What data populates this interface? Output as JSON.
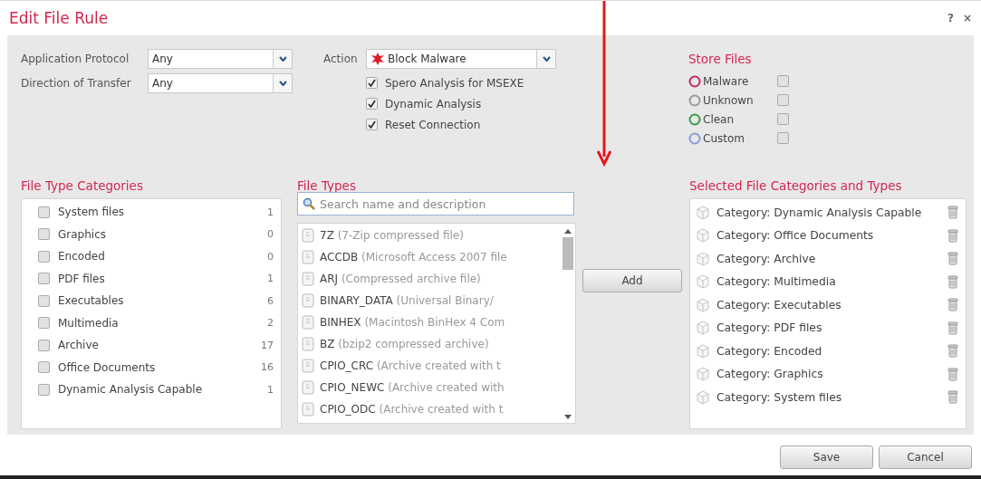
{
  "dialog": {
    "title": "Edit File Rule",
    "help": "?",
    "close": "×"
  },
  "application_protocol": {
    "label": "Application Protocol",
    "value": "Any"
  },
  "direction_of_transfer": {
    "label": "Direction of Transfer",
    "value": "Any"
  },
  "action": {
    "label": "Action",
    "value": "Block Malware",
    "options": [
      {
        "label": "Spero Analysis for MSEXE",
        "checked": true
      },
      {
        "label": "Dynamic Analysis",
        "checked": true
      },
      {
        "label": "Reset Connection",
        "checked": true
      }
    ]
  },
  "store_files": {
    "title": "Store Files",
    "items": [
      {
        "label": "Malware",
        "color": "#c8285a",
        "checked": false
      },
      {
        "label": "Unknown",
        "color": "#9a9a9a",
        "checked": false
      },
      {
        "label": "Clean",
        "color": "#3a9a4a",
        "checked": false
      },
      {
        "label": "Custom",
        "color": "#8899dd",
        "checked": false
      }
    ]
  },
  "file_type_categories": {
    "title": "File Type Categories",
    "items": [
      {
        "label": "System files",
        "count": "1",
        "checked": false
      },
      {
        "label": "Graphics",
        "count": "0",
        "checked": false
      },
      {
        "label": "Encoded",
        "count": "0",
        "checked": false
      },
      {
        "label": "PDF files",
        "count": "1",
        "checked": false
      },
      {
        "label": "Executables",
        "count": "6",
        "checked": false
      },
      {
        "label": "Multimedia",
        "count": "2",
        "checked": false
      },
      {
        "label": "Archive",
        "count": "17",
        "checked": false
      },
      {
        "label": "Office Documents",
        "count": "16",
        "checked": false
      },
      {
        "label": "Dynamic Analysis Capable",
        "count": "1",
        "checked": false
      }
    ]
  },
  "file_types": {
    "title": "File Types",
    "search": {
      "placeholder": "Search name and description"
    },
    "items": [
      {
        "name": "7Z",
        "description": "(7-Zip compressed file)"
      },
      {
        "name": "ACCDB",
        "description": "(Microsoft Access 2007 file"
      },
      {
        "name": "ARJ",
        "description": "(Compressed archive file)"
      },
      {
        "name": "BINARY_DATA",
        "description": "(Universal Binary/"
      },
      {
        "name": "BINHEX",
        "description": "(Macintosh BinHex 4 Com"
      },
      {
        "name": "BZ",
        "description": "(bzip2 compressed archive)"
      },
      {
        "name": "CPIO_CRC",
        "description": "(Archive created with t"
      },
      {
        "name": "CPIO_NEWC",
        "description": "(Archive created with"
      },
      {
        "name": "CPIO_ODC",
        "description": "(Archive created with t"
      }
    ]
  },
  "add_button": "Add",
  "selected": {
    "title": "Selected File Categories and Types",
    "items": [
      "Category: Dynamic Analysis Capable",
      "Category: Office Documents",
      "Category: Archive",
      "Category: Multimedia",
      "Category: Executables",
      "Category: PDF files",
      "Category: Encoded",
      "Category: Graphics",
      "Category: System files"
    ]
  },
  "buttons": [
    {
      "label": "Save"
    },
    {
      "label": "Cancel"
    }
  ]
}
